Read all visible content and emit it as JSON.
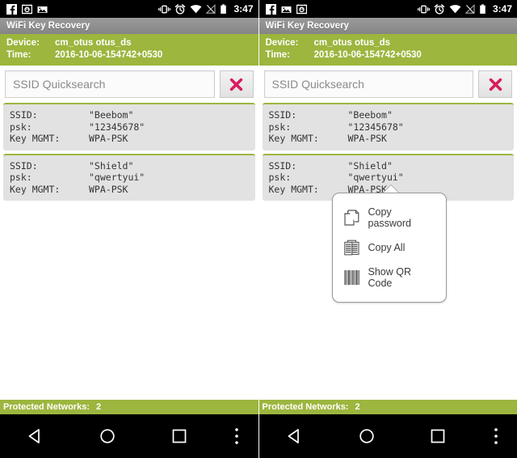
{
  "status_bar": {
    "time": "3:47",
    "left_icons": [
      "facebook-icon",
      "camera-icon",
      "gallery-icon"
    ],
    "left_icons_right_panel": [
      "facebook-icon",
      "gallery-icon",
      "camera-icon"
    ],
    "right_icons": [
      "vibrate-icon",
      "alarm-icon",
      "wifi-icon",
      "signal-icon",
      "battery-icon"
    ]
  },
  "app": {
    "title": "WiFi Key Recovery"
  },
  "info": {
    "device_label": "Device:",
    "device_value": "cm_otus otus_ds",
    "time_label": "Time:",
    "time_value": "2016-10-06-154742+0530"
  },
  "search": {
    "placeholder": "SSID Quicksearch",
    "value": "",
    "clear_icon": "close-x-icon"
  },
  "networks": [
    {
      "ssid_label": "SSID:",
      "ssid_value": "\"Beebom\"",
      "psk_label": "psk:",
      "psk_value": "\"12345678\"",
      "keymgmt_label": "Key MGMT:",
      "keymgmt_value": "WPA-PSK"
    },
    {
      "ssid_label": "SSID:",
      "ssid_value": "\"Shield\"",
      "psk_label": "psk:",
      "psk_value": "\"qwertyui\"",
      "keymgmt_label": "Key MGMT:",
      "keymgmt_value": "WPA-PSK"
    }
  ],
  "context_menu": {
    "items": [
      {
        "label": "Copy password",
        "icon": "copy-pages-icon"
      },
      {
        "label": "Copy All",
        "icon": "copy-all-documents-icon"
      },
      {
        "label": "Show QR Code",
        "icon": "barcode-icon"
      }
    ]
  },
  "footer": {
    "label": "Protected Networks:",
    "count": "2"
  },
  "nav_bar": {
    "back": "back-triangle-icon",
    "home": "home-circle-icon",
    "recents": "recents-square-icon",
    "overflow": "overflow-dots-icon"
  },
  "colors": {
    "green": "#9cb63e",
    "titlebar_gray": "#8e8e8e",
    "card_gray": "#e2e2e2",
    "clear_red": "#d81b5e",
    "black": "#000000"
  }
}
